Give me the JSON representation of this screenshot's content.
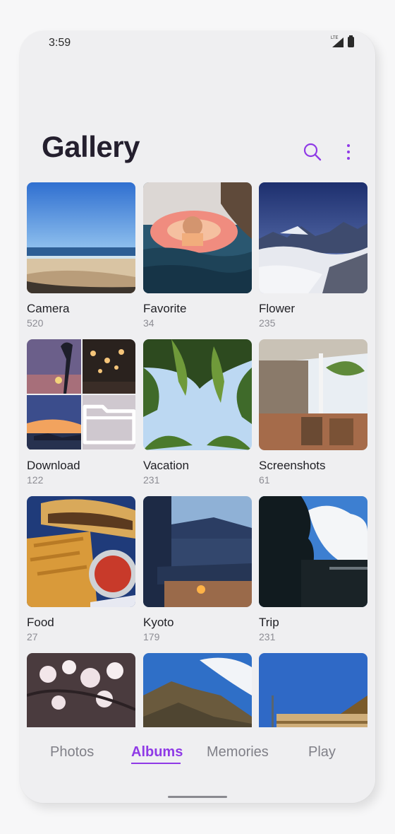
{
  "status_bar": {
    "time": "3:59",
    "network": "LTE"
  },
  "header": {
    "title": "Gallery",
    "search_icon": "search-icon",
    "more_icon": "more-vert-icon"
  },
  "albums": [
    {
      "name": "Camera",
      "count": "520"
    },
    {
      "name": "Favorite",
      "count": "34"
    },
    {
      "name": "Flower",
      "count": "235"
    },
    {
      "name": "Download",
      "count": "122"
    },
    {
      "name": "Vacation",
      "count": "231"
    },
    {
      "name": "Screenshots",
      "count": "61"
    },
    {
      "name": "Food",
      "count": "27"
    },
    {
      "name": "Kyoto",
      "count": "179"
    },
    {
      "name": "Trip",
      "count": "231"
    }
  ],
  "tabs": [
    {
      "label": "Photos",
      "active": false
    },
    {
      "label": "Albums",
      "active": true
    },
    {
      "label": "Memories",
      "active": false
    },
    {
      "label": "Play",
      "active": false
    }
  ],
  "colors": {
    "accent": "#8f3ae6",
    "title": "#241f2e",
    "muted": "#808088"
  }
}
